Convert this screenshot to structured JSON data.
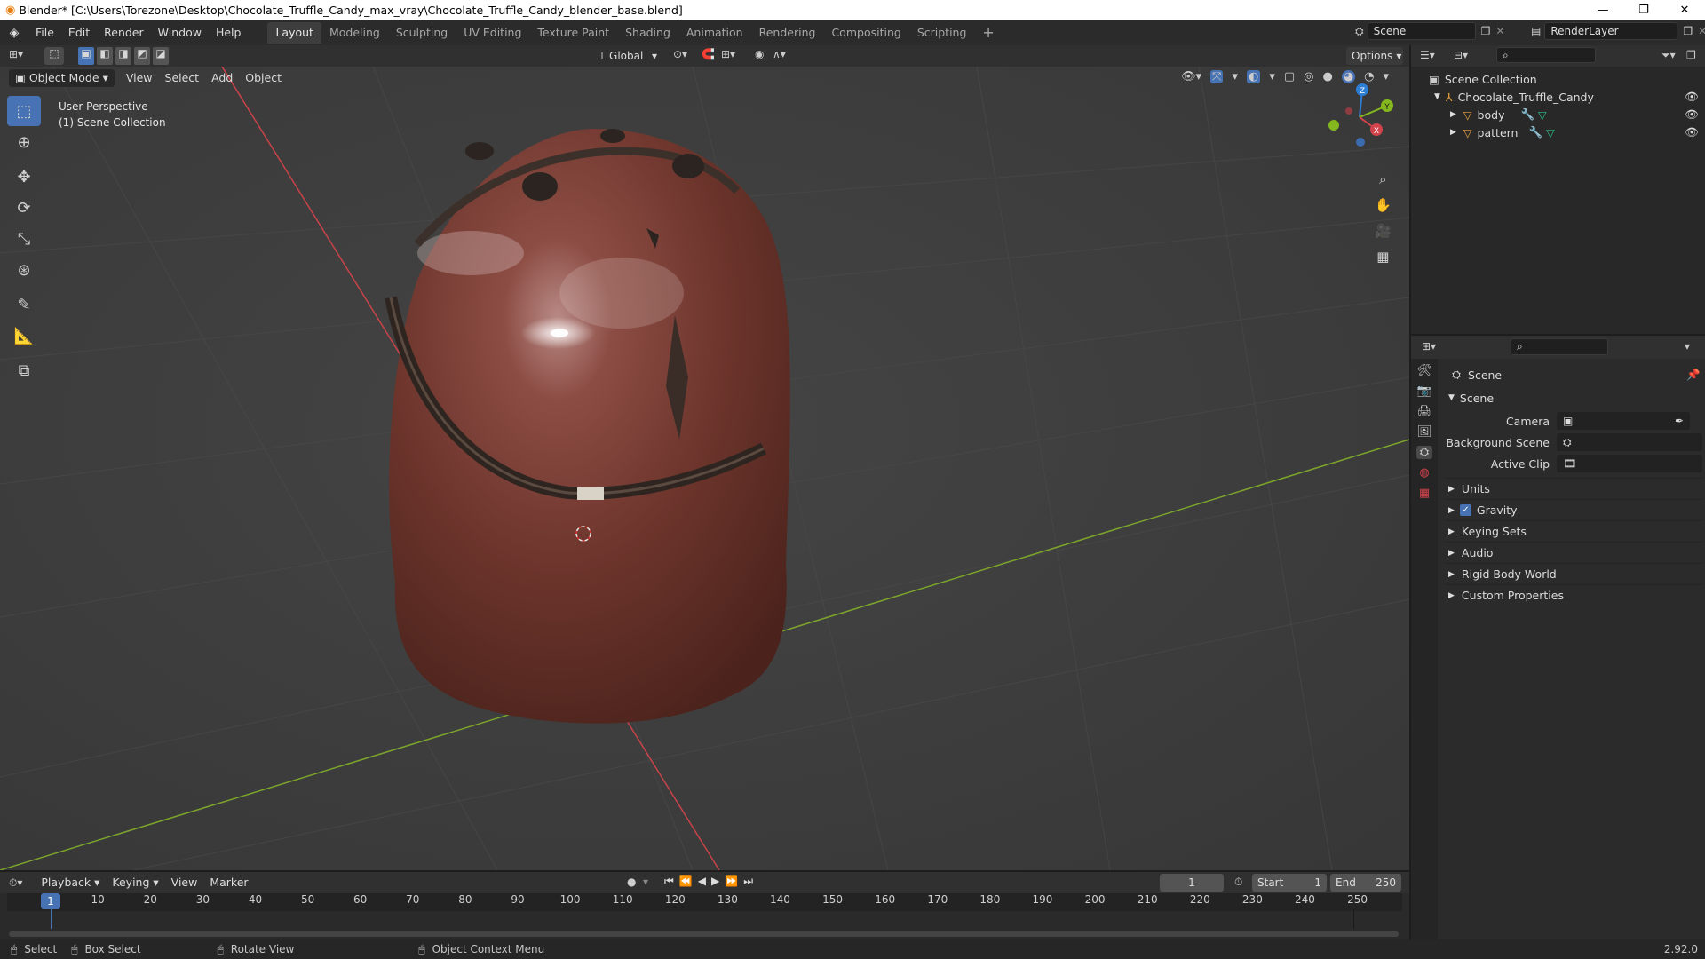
{
  "titlebar": {
    "title": "Blender* [C:\\Users\\Torezone\\Desktop\\Chocolate_Truffle_Candy_max_vray\\Chocolate_Truffle_Candy_blender_base.blend]"
  },
  "menu": [
    "File",
    "Edit",
    "Render",
    "Window",
    "Help"
  ],
  "workspaces": [
    "Layout",
    "Modeling",
    "Sculpting",
    "UV Editing",
    "Texture Paint",
    "Shading",
    "Animation",
    "Rendering",
    "Compositing",
    "Scripting"
  ],
  "scene_field": "Scene",
  "renderlayer_field": "RenderLayer",
  "viewport": {
    "transform_orientation": "Global",
    "options_label": "Options",
    "mode": "Object Mode",
    "menus": [
      "View",
      "Select",
      "Add",
      "Object"
    ],
    "overlay_line1": "User Perspective",
    "overlay_line2": "(1) Scene Collection",
    "gizmo": {
      "z": "Z",
      "y": "Y",
      "x": "X"
    }
  },
  "outliner": {
    "root": "Scene Collection",
    "collection": "Chocolate_Truffle_Candy",
    "objects": [
      "body",
      "pattern"
    ]
  },
  "properties": {
    "context_title": "Scene",
    "panel_title": "Scene",
    "fields": [
      {
        "label": "Camera",
        "value": ""
      },
      {
        "label": "Background Scene",
        "value": ""
      },
      {
        "label": "Active Clip",
        "value": ""
      }
    ],
    "sections": [
      "Units",
      "Gravity",
      "Keying Sets",
      "Audio",
      "Rigid Body World",
      "Custom Properties"
    ],
    "gravity_checked": true
  },
  "timeline": {
    "menus": [
      "Playback",
      "Keying",
      "View",
      "Marker"
    ],
    "current_frame": "1",
    "start_label": "Start",
    "start_value": "1",
    "end_label": "End",
    "end_value": "250",
    "ticks": [
      "10",
      "20",
      "30",
      "40",
      "50",
      "60",
      "70",
      "80",
      "90",
      "100",
      "110",
      "120",
      "130",
      "140",
      "150",
      "160",
      "170",
      "180",
      "190",
      "200",
      "210",
      "220",
      "230",
      "240",
      "250"
    ],
    "playhead_label": "1"
  },
  "statusbar": {
    "select": "Select",
    "box_select": "Box Select",
    "rotate_view": "Rotate View",
    "context_menu": "Object Context Menu",
    "version": "2.92.0"
  },
  "colors": {
    "accent": "#4772b3",
    "x_axis": "#d2434b",
    "y_axis": "#84b81e",
    "z_axis": "#2d7fd6",
    "chocolate": "#7a3f33"
  }
}
